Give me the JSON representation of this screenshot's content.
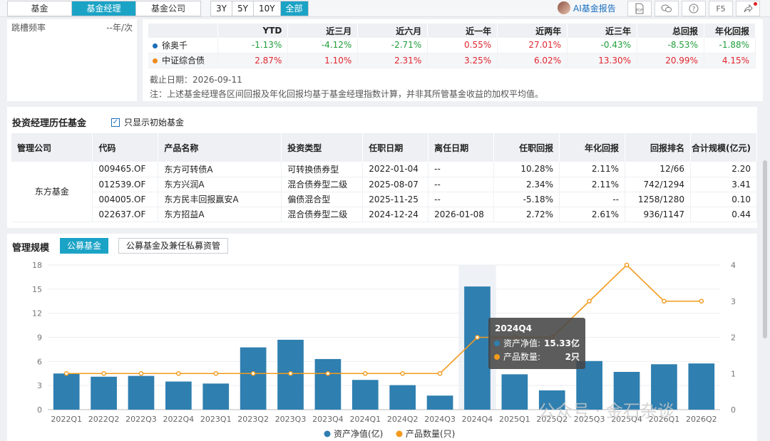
{
  "top_tabs": [
    "基金",
    "基金经理",
    "基金公司"
  ],
  "ranges": [
    "3Y",
    "5Y",
    "10Y",
    "全部"
  ],
  "ai_report": "AI基金报告",
  "tools": [
    "PDF",
    "wechat-icon",
    "help-icon",
    "F5",
    "share-icon"
  ],
  "left": {
    "label": "跳槽频率",
    "value": "--年/次"
  },
  "returns": {
    "headers": [
      "",
      "YTD",
      "近三月",
      "近六月",
      "近一年",
      "近两年",
      "近三年",
      "总回报",
      "年化回报"
    ],
    "rows": [
      {
        "name": "徐奥千",
        "color": "#1b6fb8",
        "values": [
          "-1.13%",
          "-4.12%",
          "-2.71%",
          "0.55%",
          "27.01%",
          "-0.43%",
          "-8.53%",
          "-1.88%"
        ]
      },
      {
        "name": "中证综合债",
        "color": "#f08a1c",
        "values": [
          "2.87%",
          "1.10%",
          "2.31%",
          "3.25%",
          "6.02%",
          "13.30%",
          "20.99%",
          "4.15%"
        ]
      }
    ],
    "date_note": "截止日期：2026-09-11",
    "footnote": "注：上述基金经理各区间回报及年化回报均基于基金经理指数计算，并非其所管基金收益的加权平均值。"
  },
  "history": {
    "title": "投资经理历任基金",
    "checkbox_label": "只显示初始基金",
    "headers": [
      "管理公司",
      "代码",
      "产品名称",
      "投资类型",
      "任职日期",
      "离任日期",
      "任职回报",
      "年化回报",
      "回报排名",
      "合计规模(亿元)"
    ],
    "company": "东方基金",
    "rows": [
      [
        "009465.OF",
        "东方可转债A",
        "可转换债券型",
        "2022-01-04",
        "--",
        "10.28%",
        "2.11%",
        "12/66",
        "2.20"
      ],
      [
        "012539.OF",
        "东方兴润A",
        "混合债券型二级",
        "2025-08-07",
        "--",
        "2.34%",
        "2.11%",
        "742/1294",
        "3.41"
      ],
      [
        "004005.OF",
        "东方民丰回报赢安A",
        "偏债混合型",
        "2025-11-25",
        "--",
        "-5.18%",
        "--",
        "1258/1280",
        "0.10"
      ],
      [
        "022637.OF",
        "东方招益A",
        "混合债券型二级",
        "2024-12-24",
        "2026-01-08",
        "2.72%",
        "2.61%",
        "936/1147",
        "0.44"
      ]
    ]
  },
  "scale": {
    "title": "管理规模",
    "btn_public": "公募基金",
    "btn_all": "公募基金及兼任私募资管",
    "watermark": "公众号 · 金石杂谈"
  },
  "chart_data": {
    "type": "bar",
    "categories": [
      "2022Q1",
      "2022Q2",
      "2022Q3",
      "2022Q4",
      "2023Q1",
      "2023Q2",
      "2023Q3",
      "2023Q4",
      "2024Q1",
      "2024Q2",
      "2024Q3",
      "2024Q4",
      "2025Q1",
      "2025Q2",
      "2025Q3",
      "2025Q4",
      "2026Q1",
      "2026Q2"
    ],
    "series": [
      {
        "name": "资产净值(亿)",
        "type": "bar",
        "axis": "left",
        "color": "#2f7fb0",
        "values": [
          4.5,
          4.1,
          4.2,
          3.5,
          3.25,
          7.75,
          8.7,
          6.3,
          3.7,
          3.05,
          1.75,
          15.33,
          4.4,
          2.4,
          6.05,
          4.7,
          5.65,
          5.75
        ]
      },
      {
        "name": "产品数量(只)",
        "type": "line",
        "axis": "right",
        "color": "#f39a1e",
        "values": [
          1,
          1,
          1,
          1,
          1,
          1,
          1,
          1,
          1,
          1,
          1,
          2,
          2,
          2,
          3,
          4,
          3,
          3
        ]
      }
    ],
    "y_left": {
      "ticks": [
        0,
        3,
        6,
        9,
        12,
        15,
        18
      ],
      "lim": [
        0,
        18
      ]
    },
    "y_right": {
      "ticks": [
        0,
        1,
        2,
        3,
        4
      ],
      "lim": [
        0,
        4
      ]
    },
    "highlight_category": "2024Q4",
    "tooltip": {
      "title": "2024Q4",
      "rows": [
        {
          "label": "资产净值:",
          "value": "15.33亿",
          "color": "#2f7fb0"
        },
        {
          "label": "产品数量:",
          "value": "2只",
          "color": "#f39a1e"
        }
      ]
    },
    "legend_position": "bottom"
  }
}
